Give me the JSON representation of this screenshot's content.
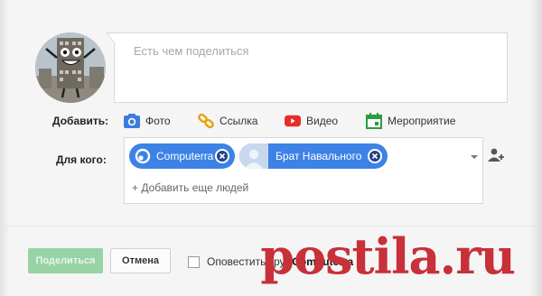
{
  "compose": {
    "placeholder": "Есть чем поделиться"
  },
  "attach": {
    "label": "Добавить:",
    "items": [
      {
        "label": "Фото",
        "icon": "camera-icon",
        "color": "#3b7ddd"
      },
      {
        "label": "Ссылка",
        "icon": "link-icon",
        "color": "#e7a100"
      },
      {
        "label": "Видео",
        "icon": "youtube-icon",
        "color": "#e52d27"
      },
      {
        "label": "Мероприятие",
        "icon": "calendar-icon",
        "color": "#2a9d3e"
      }
    ]
  },
  "audience": {
    "label": "Для кого:",
    "chips": [
      {
        "label": "Computerra",
        "icon": "circles-icon"
      },
      {
        "label": "Брат Навального",
        "icon": "person-avatar"
      }
    ],
    "add_more": "+ Добавить еще людей"
  },
  "footer": {
    "share_label": "Поделиться",
    "cancel_label": "Отмена",
    "notify_prefix": "Оповестить круг ",
    "notify_circle": "Computerra"
  },
  "watermark": "postila.ru",
  "colors": {
    "chip": "#3d82e6",
    "share_button": "#98d3a5",
    "watermark": "#c8303a"
  }
}
